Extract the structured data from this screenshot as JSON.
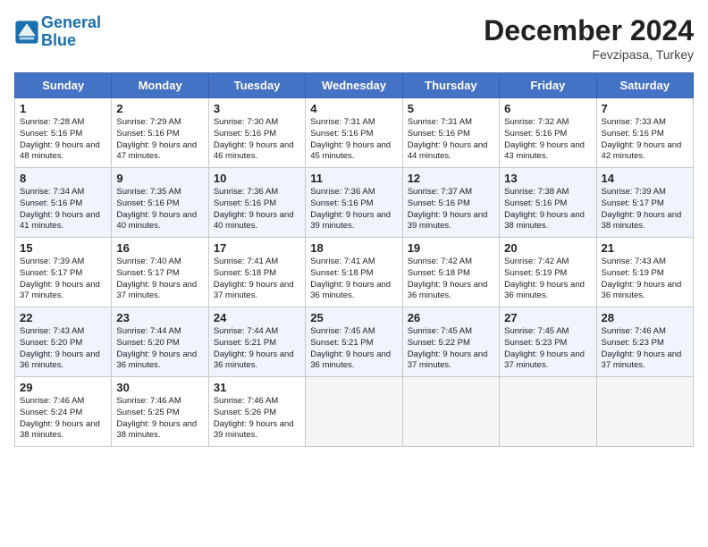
{
  "header": {
    "logo_line1": "General",
    "logo_line2": "Blue",
    "month_title": "December 2024",
    "location": "Fevzipasa, Turkey"
  },
  "weekdays": [
    "Sunday",
    "Monday",
    "Tuesday",
    "Wednesday",
    "Thursday",
    "Friday",
    "Saturday"
  ],
  "weeks": [
    [
      {
        "day": "1",
        "sunrise": "Sunrise: 7:28 AM",
        "sunset": "Sunset: 5:16 PM",
        "daylight": "Daylight: 9 hours and 48 minutes."
      },
      {
        "day": "2",
        "sunrise": "Sunrise: 7:29 AM",
        "sunset": "Sunset: 5:16 PM",
        "daylight": "Daylight: 9 hours and 47 minutes."
      },
      {
        "day": "3",
        "sunrise": "Sunrise: 7:30 AM",
        "sunset": "Sunset: 5:16 PM",
        "daylight": "Daylight: 9 hours and 46 minutes."
      },
      {
        "day": "4",
        "sunrise": "Sunrise: 7:31 AM",
        "sunset": "Sunset: 5:16 PM",
        "daylight": "Daylight: 9 hours and 45 minutes."
      },
      {
        "day": "5",
        "sunrise": "Sunrise: 7:31 AM",
        "sunset": "Sunset: 5:16 PM",
        "daylight": "Daylight: 9 hours and 44 minutes."
      },
      {
        "day": "6",
        "sunrise": "Sunrise: 7:32 AM",
        "sunset": "Sunset: 5:16 PM",
        "daylight": "Daylight: 9 hours and 43 minutes."
      },
      {
        "day": "7",
        "sunrise": "Sunrise: 7:33 AM",
        "sunset": "Sunset: 5:16 PM",
        "daylight": "Daylight: 9 hours and 42 minutes."
      }
    ],
    [
      {
        "day": "8",
        "sunrise": "Sunrise: 7:34 AM",
        "sunset": "Sunset: 5:16 PM",
        "daylight": "Daylight: 9 hours and 41 minutes."
      },
      {
        "day": "9",
        "sunrise": "Sunrise: 7:35 AM",
        "sunset": "Sunset: 5:16 PM",
        "daylight": "Daylight: 9 hours and 40 minutes."
      },
      {
        "day": "10",
        "sunrise": "Sunrise: 7:36 AM",
        "sunset": "Sunset: 5:16 PM",
        "daylight": "Daylight: 9 hours and 40 minutes."
      },
      {
        "day": "11",
        "sunrise": "Sunrise: 7:36 AM",
        "sunset": "Sunset: 5:16 PM",
        "daylight": "Daylight: 9 hours and 39 minutes."
      },
      {
        "day": "12",
        "sunrise": "Sunrise: 7:37 AM",
        "sunset": "Sunset: 5:16 PM",
        "daylight": "Daylight: 9 hours and 39 minutes."
      },
      {
        "day": "13",
        "sunrise": "Sunrise: 7:38 AM",
        "sunset": "Sunset: 5:16 PM",
        "daylight": "Daylight: 9 hours and 38 minutes."
      },
      {
        "day": "14",
        "sunrise": "Sunrise: 7:39 AM",
        "sunset": "Sunset: 5:17 PM",
        "daylight": "Daylight: 9 hours and 38 minutes."
      }
    ],
    [
      {
        "day": "15",
        "sunrise": "Sunrise: 7:39 AM",
        "sunset": "Sunset: 5:17 PM",
        "daylight": "Daylight: 9 hours and 37 minutes."
      },
      {
        "day": "16",
        "sunrise": "Sunrise: 7:40 AM",
        "sunset": "Sunset: 5:17 PM",
        "daylight": "Daylight: 9 hours and 37 minutes."
      },
      {
        "day": "17",
        "sunrise": "Sunrise: 7:41 AM",
        "sunset": "Sunset: 5:18 PM",
        "daylight": "Daylight: 9 hours and 37 minutes."
      },
      {
        "day": "18",
        "sunrise": "Sunrise: 7:41 AM",
        "sunset": "Sunset: 5:18 PM",
        "daylight": "Daylight: 9 hours and 36 minutes."
      },
      {
        "day": "19",
        "sunrise": "Sunrise: 7:42 AM",
        "sunset": "Sunset: 5:18 PM",
        "daylight": "Daylight: 9 hours and 36 minutes."
      },
      {
        "day": "20",
        "sunrise": "Sunrise: 7:42 AM",
        "sunset": "Sunset: 5:19 PM",
        "daylight": "Daylight: 9 hours and 36 minutes."
      },
      {
        "day": "21",
        "sunrise": "Sunrise: 7:43 AM",
        "sunset": "Sunset: 5:19 PM",
        "daylight": "Daylight: 9 hours and 36 minutes."
      }
    ],
    [
      {
        "day": "22",
        "sunrise": "Sunrise: 7:43 AM",
        "sunset": "Sunset: 5:20 PM",
        "daylight": "Daylight: 9 hours and 36 minutes."
      },
      {
        "day": "23",
        "sunrise": "Sunrise: 7:44 AM",
        "sunset": "Sunset: 5:20 PM",
        "daylight": "Daylight: 9 hours and 36 minutes."
      },
      {
        "day": "24",
        "sunrise": "Sunrise: 7:44 AM",
        "sunset": "Sunset: 5:21 PM",
        "daylight": "Daylight: 9 hours and 36 minutes."
      },
      {
        "day": "25",
        "sunrise": "Sunrise: 7:45 AM",
        "sunset": "Sunset: 5:21 PM",
        "daylight": "Daylight: 9 hours and 36 minutes."
      },
      {
        "day": "26",
        "sunrise": "Sunrise: 7:45 AM",
        "sunset": "Sunset: 5:22 PM",
        "daylight": "Daylight: 9 hours and 37 minutes."
      },
      {
        "day": "27",
        "sunrise": "Sunrise: 7:45 AM",
        "sunset": "Sunset: 5:23 PM",
        "daylight": "Daylight: 9 hours and 37 minutes."
      },
      {
        "day": "28",
        "sunrise": "Sunrise: 7:46 AM",
        "sunset": "Sunset: 5:23 PM",
        "daylight": "Daylight: 9 hours and 37 minutes."
      }
    ],
    [
      {
        "day": "29",
        "sunrise": "Sunrise: 7:46 AM",
        "sunset": "Sunset: 5:24 PM",
        "daylight": "Daylight: 9 hours and 38 minutes."
      },
      {
        "day": "30",
        "sunrise": "Sunrise: 7:46 AM",
        "sunset": "Sunset: 5:25 PM",
        "daylight": "Daylight: 9 hours and 38 minutes."
      },
      {
        "day": "31",
        "sunrise": "Sunrise: 7:46 AM",
        "sunset": "Sunset: 5:26 PM",
        "daylight": "Daylight: 9 hours and 39 minutes."
      },
      null,
      null,
      null,
      null
    ]
  ]
}
